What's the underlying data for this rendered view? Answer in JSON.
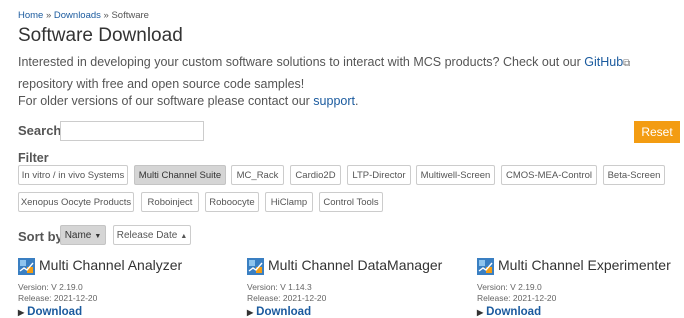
{
  "breadcrumb": {
    "home": "Home",
    "sep1": " » ",
    "downloads": "Downloads",
    "sep2": " » ",
    "current": "Software"
  },
  "page_title": "Software Download",
  "intro": {
    "text_before": "Interested in developing your custom software solutions to interact with MCS products? Check out our ",
    "github_link": "GitHub",
    "external_icon": "⧉",
    "text_after": " repository with free and open source code samples!"
  },
  "older": {
    "text_before": "For older versions of our software please contact our ",
    "support_link": "support",
    "text_after": "."
  },
  "search": {
    "label": "Search",
    "value": ""
  },
  "reset_label": "Reset",
  "filter": {
    "label": "Filter",
    "chips": [
      "In vitro / in vivo Systems",
      "Multi Channel Suite",
      "MC_Rack",
      "Cardio2D",
      "LTP-Director",
      "Multiwell-Screen",
      "CMOS-MEA-Control",
      "Beta-Screen",
      "Xenopus Oocyte Products",
      "Roboinject",
      "Roboocyte",
      "HiClamp",
      "Control Tools"
    ],
    "active": "Multi Channel Suite"
  },
  "sort": {
    "label": "Sort by",
    "name_label": "Name",
    "name_caret": "▼",
    "date_label": "Release Date",
    "date_caret": "▲",
    "active": "Name"
  },
  "products": [
    {
      "name": "Multi Channel Analyzer",
      "version": "Version: V 2.19.0",
      "release": "Release: 2021-12-20",
      "download": "Download",
      "icon": "mcs-software-icon"
    },
    {
      "name": "Multi Channel DataManager",
      "version": "Version: V 1.14.3",
      "release": "Release: 2021-12-20",
      "download": "Download",
      "icon": "mcs-software-icon"
    },
    {
      "name": "Multi Channel Experimenter",
      "version": "Version: V 2.19.0",
      "release": "Release: 2021-12-20",
      "download": "Download",
      "icon": "mcs-software-icon"
    }
  ],
  "colors": {
    "link": "#1a5a9e",
    "accent": "#f39c12",
    "active_chip": "#d5d5d5"
  }
}
